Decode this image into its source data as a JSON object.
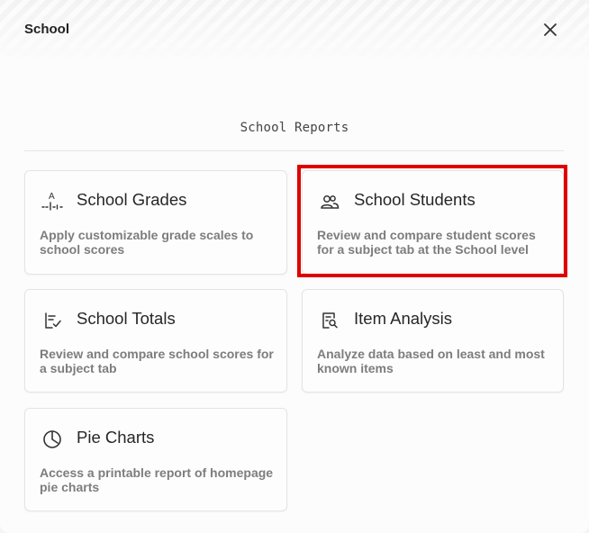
{
  "dialog": {
    "title": "School",
    "close_icon": "close-icon"
  },
  "section": {
    "title": "School Reports"
  },
  "cards": [
    {
      "title": "School Grades",
      "description": "Apply customizable grade scales to school scores",
      "icon": "grade-scale-icon"
    },
    {
      "title": "School Students",
      "description": "Review and compare student scores for a subject tab at the School level",
      "icon": "students-icon"
    },
    {
      "title": "School Totals",
      "description": "Review and compare school scores for a subject tab",
      "icon": "checklist-icon"
    },
    {
      "title": "Item Analysis",
      "description": "Analyze data based on least and most known items",
      "icon": "document-search-icon"
    },
    {
      "title": "Pie Charts",
      "description": "Access a printable report of homepage pie charts",
      "icon": "pie-chart-icon"
    }
  ],
  "highlight_color": "#e00000"
}
